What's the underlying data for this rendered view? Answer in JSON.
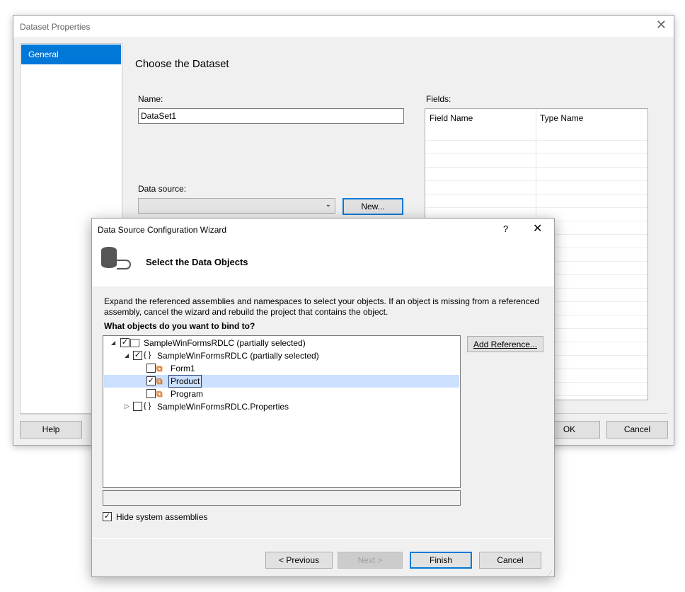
{
  "dataset_dialog": {
    "title": "Dataset Properties",
    "sidebar": [
      {
        "label": "General",
        "selected": true
      }
    ],
    "heading": "Choose the Dataset",
    "name_label": "Name:",
    "name_value": "DataSet1",
    "datasource_label": "Data source:",
    "datasource_value": "",
    "new_button": "New...",
    "fields_label": "Fields:",
    "fields_columns": [
      "Field Name",
      "Type Name"
    ],
    "help_button": "Help",
    "ok_button": "OK",
    "cancel_button": "Cancel"
  },
  "wizard": {
    "title": "Data Source Configuration Wizard",
    "help_glyph": "?",
    "heading": "Select the Data Objects",
    "description": "Expand the referenced assemblies and namespaces to select your objects. If an object is missing from a referenced assembly, cancel the wizard and rebuild the project that contains the object.",
    "question": "What objects do you want to bind to?",
    "tree": [
      {
        "label": "SampleWinFormsRDLC (partially selected)",
        "icon": "assembly-icon",
        "checked": true,
        "expanded": true,
        "level": 0
      },
      {
        "label": "SampleWinFormsRDLC (partially selected)",
        "icon": "namespace-icon",
        "checked": true,
        "expanded": true,
        "level": 1
      },
      {
        "label": "Form1",
        "icon": "class-icon",
        "checked": false,
        "level": 2
      },
      {
        "label": "Product",
        "icon": "class-icon",
        "checked": true,
        "selected": true,
        "level": 2
      },
      {
        "label": "Program",
        "icon": "class-icon",
        "checked": false,
        "level": 2
      },
      {
        "label": "SampleWinFormsRDLC.Properties",
        "icon": "namespace-icon",
        "checked": false,
        "expanded": false,
        "level": 1
      }
    ],
    "add_reference_button": "Add Reference...",
    "hide_system_label": "Hide system assemblies",
    "hide_system_checked": true,
    "previous_button": "< Previous",
    "next_button": "Next >",
    "finish_button": "Finish",
    "cancel_button": "Cancel"
  },
  "colors": {
    "accent": "#0078d7",
    "selection": "#cce0ff"
  }
}
